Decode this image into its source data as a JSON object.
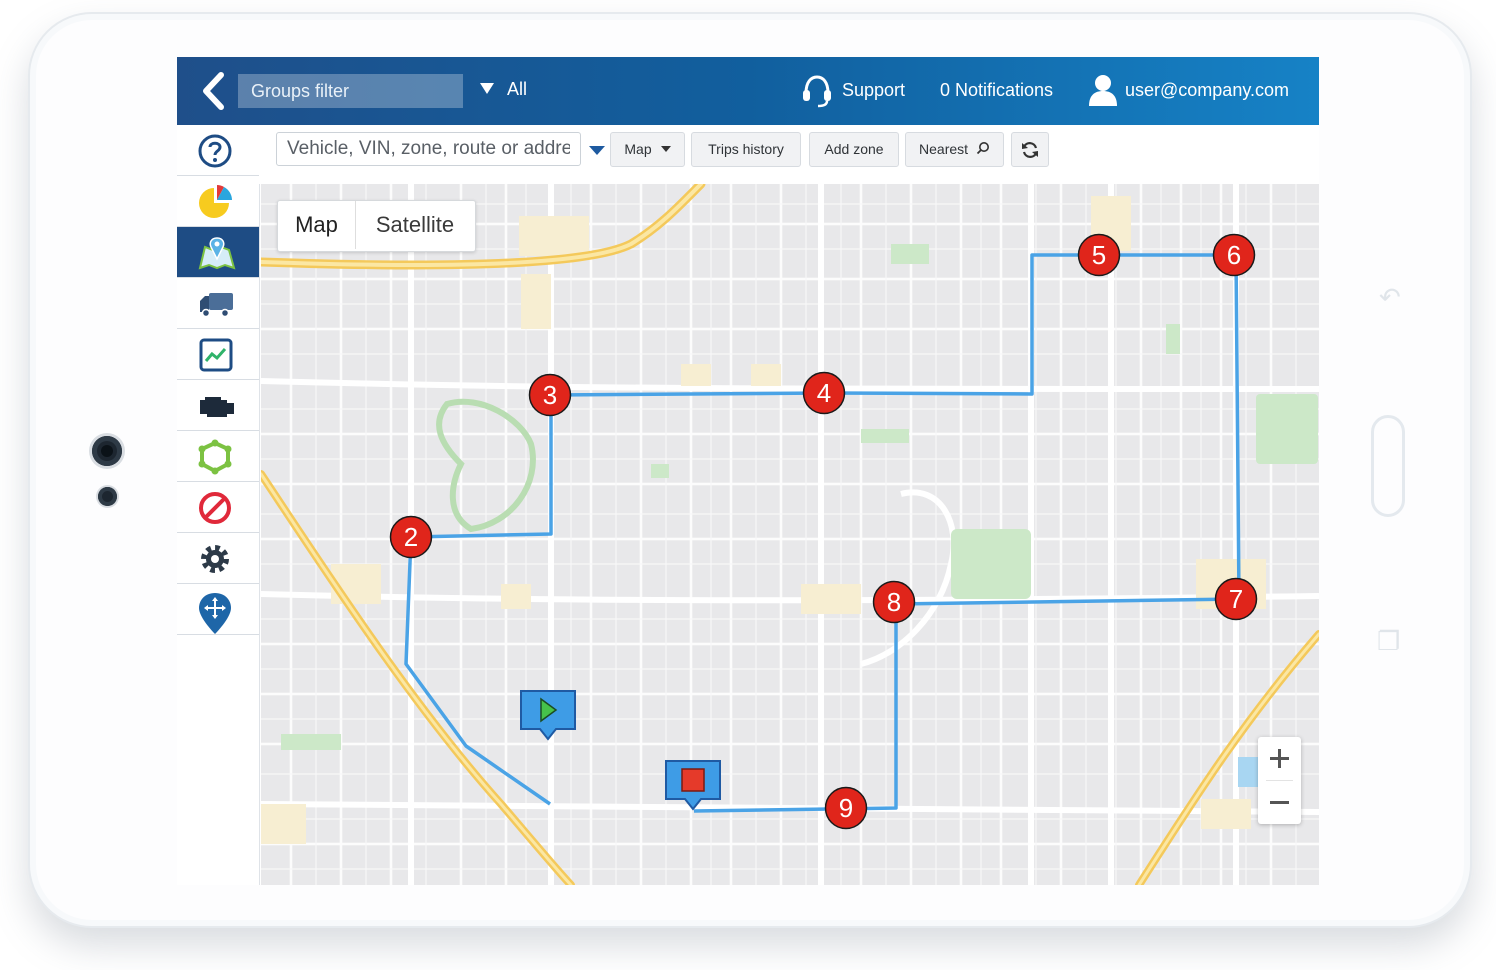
{
  "topbar": {
    "groups_filter_placeholder": "Groups filter",
    "all_label": "All",
    "support_label": "Support",
    "notifications_label": "0 Notifications",
    "user_email": "user@company.com"
  },
  "sidebar": {
    "items": [
      {
        "icon": "help-icon",
        "active": false
      },
      {
        "icon": "pie-chart-icon",
        "active": false
      },
      {
        "icon": "map-icon",
        "active": true
      },
      {
        "icon": "truck-icon",
        "active": false
      },
      {
        "icon": "trend-chart-icon",
        "active": false
      },
      {
        "icon": "engine-icon",
        "active": false
      },
      {
        "icon": "geofence-icon",
        "active": false
      },
      {
        "icon": "forbidden-icon",
        "active": false
      },
      {
        "icon": "gear-icon",
        "active": false
      },
      {
        "icon": "move-pin-icon",
        "active": false
      }
    ]
  },
  "toolbar": {
    "search_placeholder": "Vehicle, VIN, zone, route or address",
    "map_dropdown_label": "Map",
    "trips_history_label": "Trips history",
    "add_zone_label": "Add zone",
    "nearest_label": "Nearest"
  },
  "map": {
    "map_type_map": "Map",
    "map_type_satellite": "Satellite",
    "route_color": "#4aa3e6",
    "marker_color": "#e0251b",
    "stops": [
      {
        "label": "2"
      },
      {
        "label": "3"
      },
      {
        "label": "4"
      },
      {
        "label": "5"
      },
      {
        "label": "6"
      },
      {
        "label": "7"
      },
      {
        "label": "8"
      },
      {
        "label": "9"
      }
    ],
    "start_marker_icon": "play-icon",
    "end_marker_icon": "stop-icon"
  },
  "colors": {
    "topbar_left": "#1f4f8a",
    "topbar_right": "#1682c6",
    "sidebar_active": "#1e4c84",
    "highway": "#f6d567"
  }
}
